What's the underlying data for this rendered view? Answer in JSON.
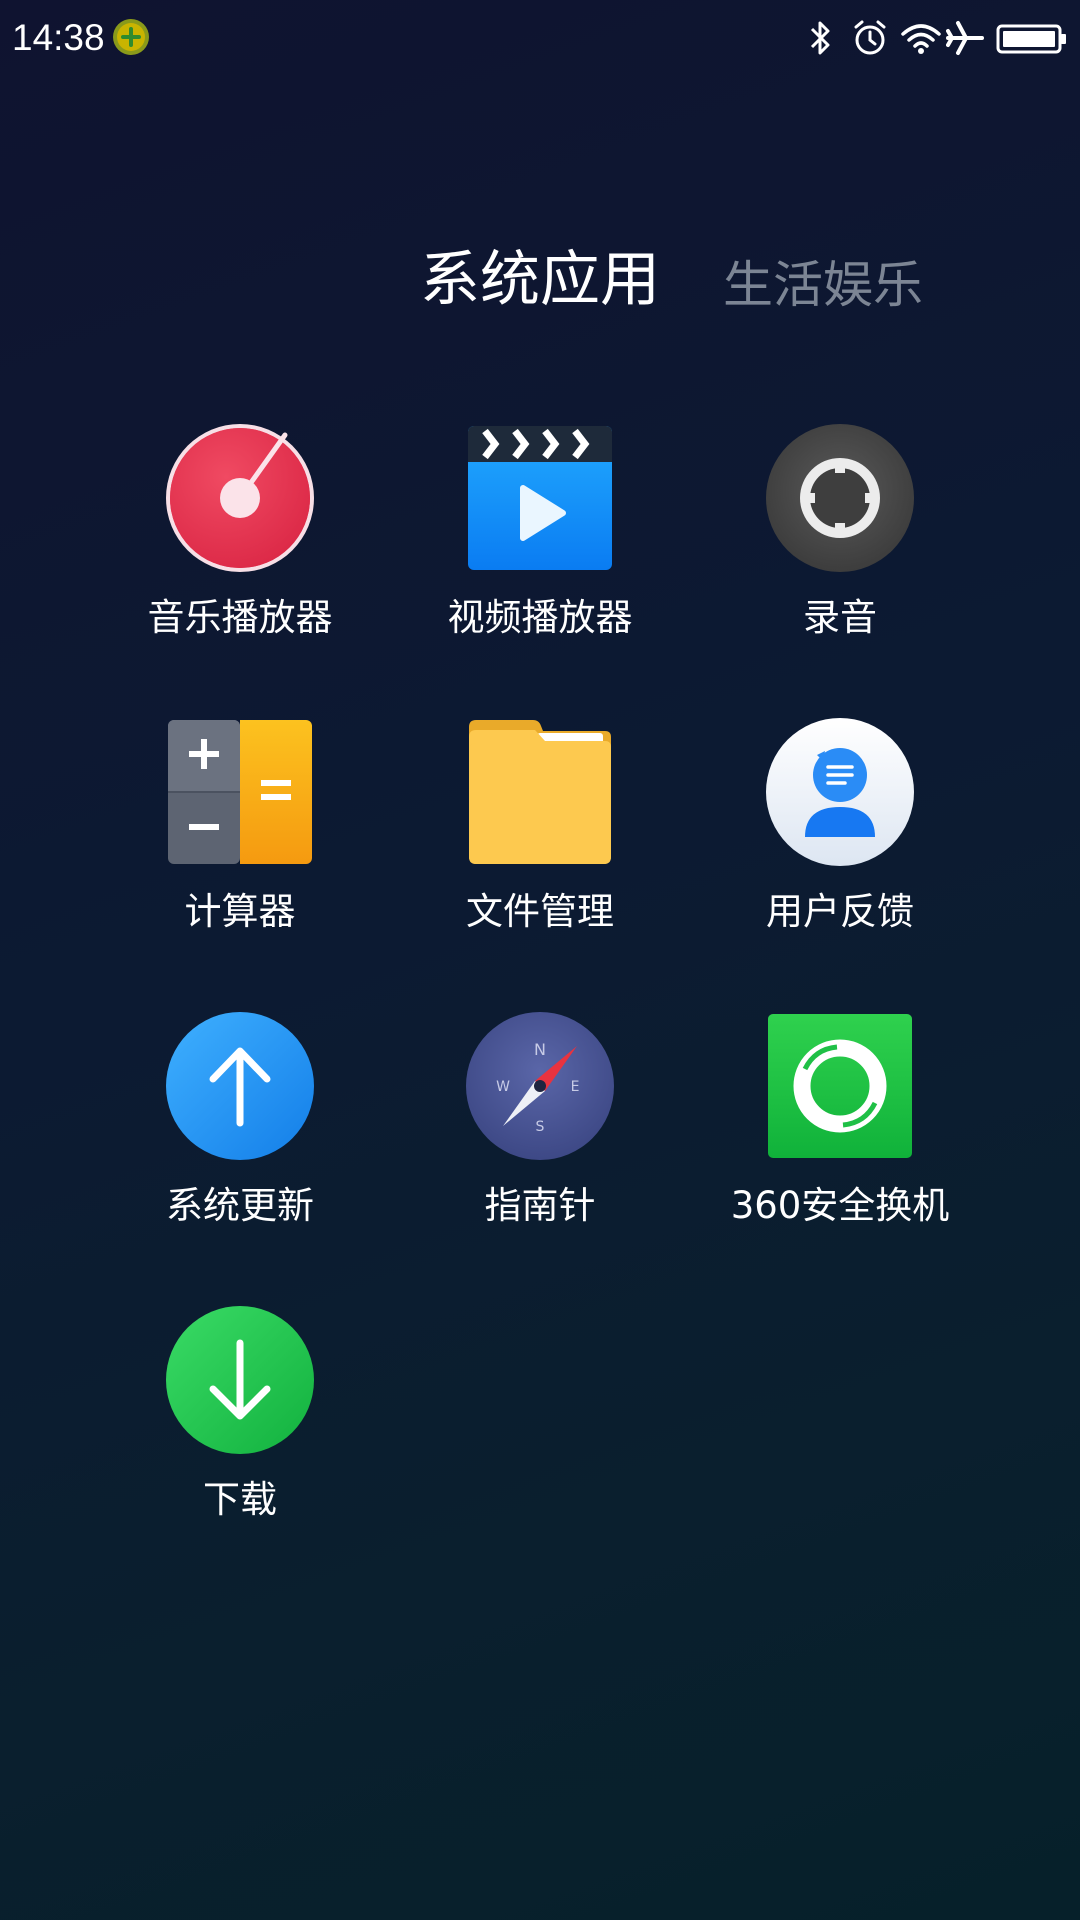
{
  "status_bar": {
    "time": "14:38",
    "icons": [
      "bluetooth-icon",
      "alarm-icon",
      "wifi-icon",
      "airplane-icon",
      "battery-icon"
    ]
  },
  "folder": {
    "tabs": [
      {
        "label": "系统应用",
        "active": true
      },
      {
        "label": "生活娱乐",
        "active": false
      }
    ]
  },
  "apps": [
    {
      "label": "音乐播放器",
      "icon": "music-player-icon"
    },
    {
      "label": "视频播放器",
      "icon": "video-player-icon"
    },
    {
      "label": "录音",
      "icon": "recorder-icon"
    },
    {
      "label": "计算器",
      "icon": "calculator-icon"
    },
    {
      "label": "文件管理",
      "icon": "folder-icon"
    },
    {
      "label": "用户反馈",
      "icon": "feedback-icon"
    },
    {
      "label": "系统更新",
      "icon": "update-arrow-icon"
    },
    {
      "label": "指南针",
      "icon": "compass-icon"
    },
    {
      "label": "360安全换机",
      "icon": "phone-clone-icon"
    },
    {
      "label": "下载",
      "icon": "download-icon"
    }
  ],
  "colors": {
    "background_top": "#0f1330",
    "background_bottom": "#06202a",
    "tab_active": "#ffffff",
    "tab_inactive": "#7c8594"
  }
}
